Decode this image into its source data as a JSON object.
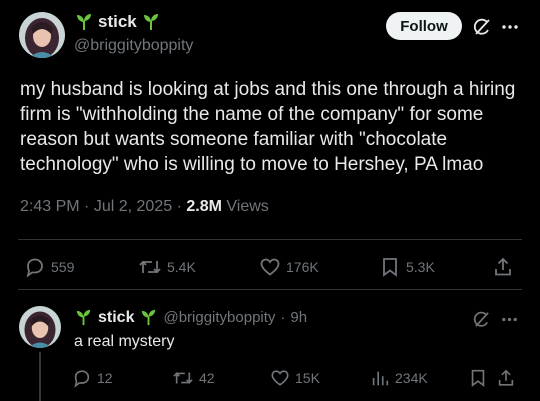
{
  "tweet": {
    "display_name": "stick",
    "handle": "@briggityboppity",
    "follow_label": "Follow",
    "text": "my husband is looking at jobs and this one through a hiring firm is \"withholding the name of the company\" for some reason but wants someone familiar with \"chocolate technology\" who is willing to move to Hershey, PA lmao",
    "time": "2:43 PM",
    "date": "Jul 2, 2025",
    "views_count": "2.8M",
    "views_label": "Views",
    "stats": {
      "replies": "559",
      "reposts": "5.4K",
      "likes": "176K",
      "bookmarks": "5.3K"
    }
  },
  "reply": {
    "display_name": "stick",
    "handle": "@briggityboppity",
    "age": "9h",
    "text": "a real mystery",
    "stats": {
      "replies": "12",
      "reposts": "42",
      "likes": "15K",
      "views": "234K"
    }
  },
  "icons": [
    "sprout-icon",
    "grok-icon",
    "more-icon",
    "reply-icon",
    "repost-icon",
    "like-icon",
    "bookmark-icon",
    "share-icon",
    "views-icon"
  ],
  "colors": {
    "background": "#000000",
    "text": "#e7e9ea",
    "muted": "#71767b",
    "sprout": "#6bc33e",
    "divider": "#2f3336"
  }
}
